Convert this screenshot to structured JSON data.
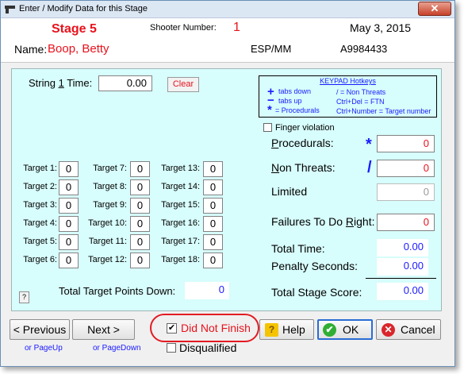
{
  "window": {
    "title": "Enter / Modify Data for this Stage",
    "close_glyph": "✕"
  },
  "header": {
    "stage_label": "Stage 5",
    "shooter_label": "Shooter Number:",
    "shooter_number": "1",
    "date": "May 3, 2015",
    "name_label": "Name:",
    "name": "Boop, Betty",
    "division": "ESP/MM",
    "member_id": "A9984433"
  },
  "string": {
    "label_pre": "String ",
    "label_num": "1",
    "label_post": " Time:",
    "value": "0.00",
    "clear_label": "Clear"
  },
  "keypad": {
    "title": "KEYPAD Hotkeys",
    "rows": [
      {
        "sym": "+",
        "text": "tabs down"
      },
      {
        "sym": "−",
        "text": "tabs up"
      },
      {
        "sym": "*",
        "text": "= Procedurals"
      }
    ],
    "right": [
      "/ = Non Threats",
      "Ctrl+Del = FTN",
      "Ctrl+Number = Target number"
    ]
  },
  "targets": [
    {
      "label": "Target 1:",
      "value": "0"
    },
    {
      "label": "Target 2:",
      "value": "0"
    },
    {
      "label": "Target 3:",
      "value": "0"
    },
    {
      "label": "Target 4:",
      "value": "0"
    },
    {
      "label": "Target 5:",
      "value": "0"
    },
    {
      "label": "Target 6:",
      "value": "0"
    },
    {
      "label": "Target 7:",
      "value": "0"
    },
    {
      "label": "Target 8:",
      "value": "0"
    },
    {
      "label": "Target 9:",
      "value": "0"
    },
    {
      "label": "Target 10:",
      "value": "0"
    },
    {
      "label": "Target 11:",
      "value": "0"
    },
    {
      "label": "Target 12:",
      "value": "0"
    },
    {
      "label": "Target 13:",
      "value": "0"
    },
    {
      "label": "Target 14:",
      "value": "0"
    },
    {
      "label": "Target 15:",
      "value": "0"
    },
    {
      "label": "Target 16:",
      "value": "0"
    },
    {
      "label": "Target 17:",
      "value": "0"
    },
    {
      "label": "Target 18:",
      "value": "0"
    }
  ],
  "totals": {
    "points_down_label": "Total Target Points Down:",
    "points_down": "0",
    "help_small": "?"
  },
  "penalties": {
    "finger_violation": "Finger violation",
    "procedurals_label": "Procedurals:",
    "procedurals_hotkey": "*",
    "procedurals": "0",
    "non_threats_label": "Non Threats:",
    "non_threats_hotkey": "/",
    "non_threats": "0",
    "limited_label": "Limited",
    "limited": "0",
    "ftdr_label": "Failures To Do Right:",
    "ftdr": "0"
  },
  "scores": {
    "total_time_label": "Total Time:",
    "total_time": "0.00",
    "penalty_seconds_label": "Penalty Seconds:",
    "penalty_seconds": "0.00",
    "stage_score_label": "Total Stage Score:",
    "stage_score": "0.00"
  },
  "buttons": {
    "previous": "< Previous",
    "previous_hint": "or PageUp",
    "next": "Next >",
    "next_hint": "or PageDown",
    "did_not_finish": "Did Not Finish",
    "disqualified": "Disqualified",
    "help": "Help",
    "ok": "OK",
    "cancel": "Cancel"
  },
  "colors": {
    "accent_red": "#e8121c",
    "value_blue": "#1a1aff",
    "panel_cyan": "#d7fdfc"
  }
}
